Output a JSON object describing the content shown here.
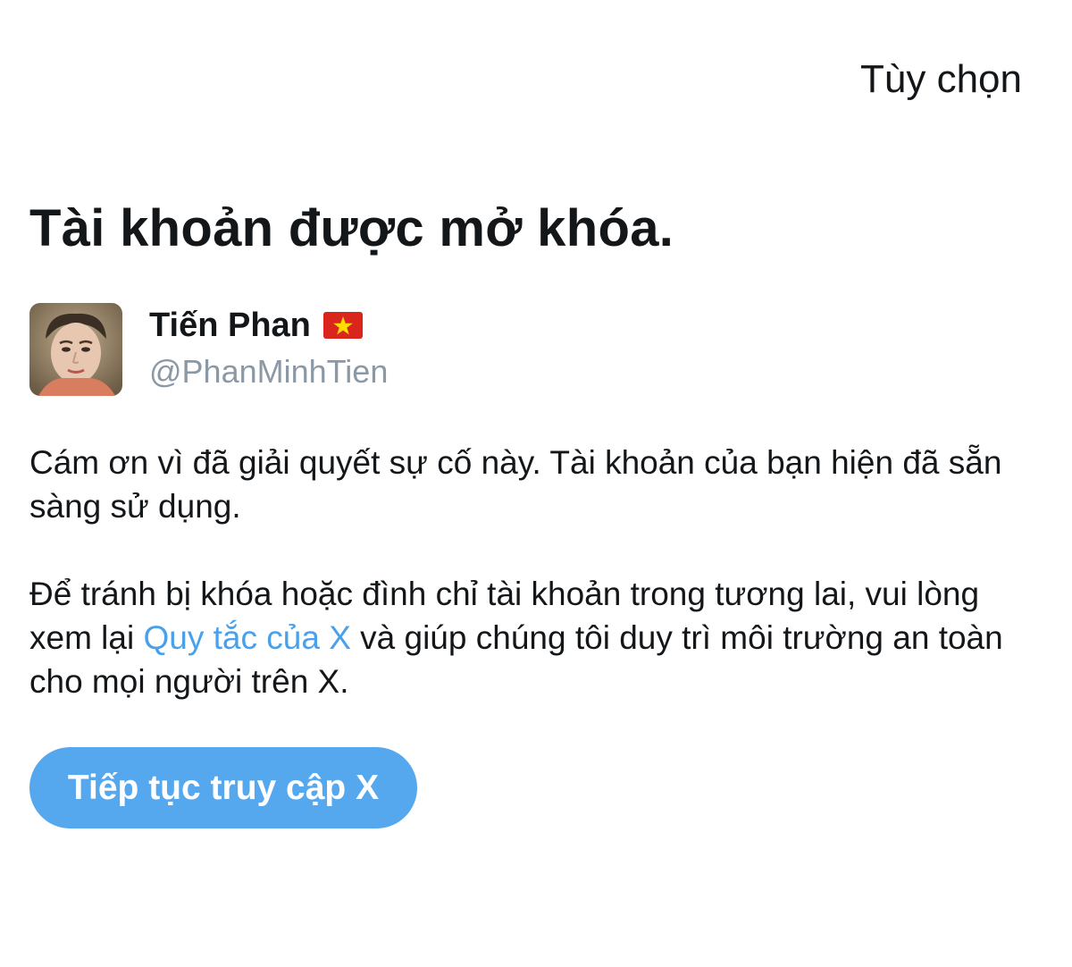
{
  "header": {
    "options_label": "Tùy chọn"
  },
  "main": {
    "title": "Tài khoản được mở khóa.",
    "profile": {
      "display_name": "Tiến Phan",
      "flag_icon": "vietnam-flag-icon",
      "handle": "@PhanMinhTien",
      "avatar_icon": "user-avatar"
    },
    "paragraph_1": "Cám ơn vì đã giải quyết sự cố này. Tài khoản của bạn hiện đã sẵn sàng sử dụng.",
    "paragraph_2": {
      "before_link": "Để tránh bị khóa hoặc đình chỉ tài khoản trong tương lai, vui lòng xem lại ",
      "link_text": "Quy tắc của X",
      "after_link": " và giúp chúng tôi duy trì môi trường an toàn cho mọi người trên X."
    },
    "continue_button_label": "Tiếp tục truy cập X"
  },
  "colors": {
    "text": "#14171a",
    "handle": "#8b98a5",
    "link": "#4aa1eb",
    "button_bg": "#55a7ee",
    "button_text": "#ffffff",
    "background": "#ffffff"
  }
}
